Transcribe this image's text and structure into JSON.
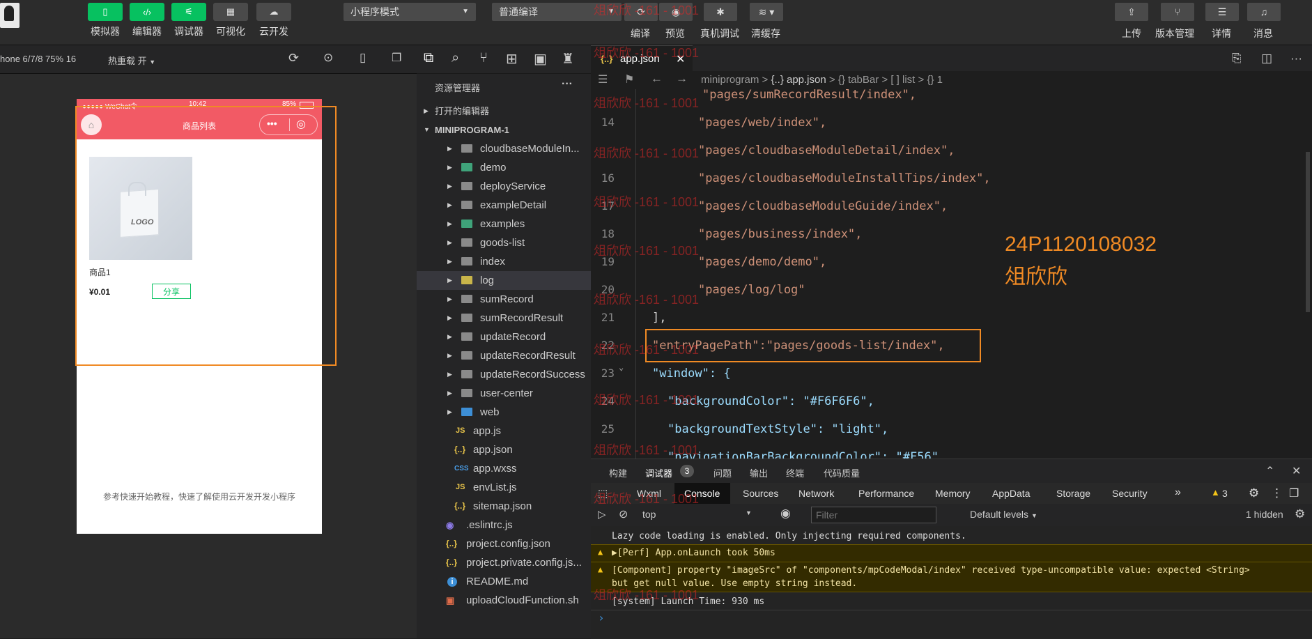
{
  "toolbar": {
    "buttons": [
      {
        "label": "模拟器",
        "icon": "phone-icon"
      },
      {
        "label": "编辑器",
        "icon": "code-icon"
      },
      {
        "label": "调试器",
        "icon": "debug-icon"
      },
      {
        "label": "可视化",
        "icon": "layout-icon"
      },
      {
        "label": "云开发",
        "icon": "cloud-icon"
      }
    ],
    "mode_select": "小程序模式",
    "compile_select": "普通编译",
    "actions": [
      {
        "label": "编译",
        "icon": "refresh-icon"
      },
      {
        "label": "预览",
        "icon": "eye-icon"
      },
      {
        "label": "真机调试",
        "icon": "bug-icon"
      },
      {
        "label": "清缓存",
        "icon": "layers-icon"
      }
    ],
    "right_actions": [
      {
        "label": "上传",
        "icon": "upload-icon"
      },
      {
        "label": "版本管理",
        "icon": "branch-icon"
      },
      {
        "label": "详情",
        "icon": "menu-icon"
      },
      {
        "label": "消息",
        "icon": "bell-icon"
      }
    ]
  },
  "simulator": {
    "device": "hone 6/7/8 75% 16",
    "hotreload": "热重载 开",
    "status_left": "●●●●● WeChat令",
    "status_time": "10:42",
    "status_battery": "85%",
    "nav_title": "商品列表",
    "product_name": "商品1",
    "product_price": "¥0.01",
    "share_label": "分享",
    "logo_text": "LOGO",
    "footer_text": "参考快速开始教程，快速了解使用云开发开发小程序"
  },
  "explorer": {
    "title": "资源管理器",
    "more": "···",
    "open_editors": "打开的编辑器",
    "project": "MINIPROGRAM-1",
    "folders": [
      "cloudbaseModuleIn...",
      "demo",
      "deployService",
      "exampleDetail",
      "examples",
      "goods-list",
      "index",
      "log",
      "sumRecord",
      "sumRecordResult",
      "updateRecord",
      "updateRecordResult",
      "updateRecordSuccess",
      "user-center",
      "web"
    ],
    "files": [
      {
        "name": "app.js",
        "icon": "JS"
      },
      {
        "name": "app.json",
        "icon": "{..}"
      },
      {
        "name": "app.wxss",
        "icon": "CSS"
      },
      {
        "name": "envList.js",
        "icon": "JS"
      },
      {
        "name": "sitemap.json",
        "icon": "{..}"
      }
    ],
    "root_files": [
      {
        "name": ".eslintrc.js",
        "icon": "◉"
      },
      {
        "name": "project.config.json",
        "icon": "{..}"
      },
      {
        "name": "project.private.config.js...",
        "icon": "{..}"
      },
      {
        "name": "README.md",
        "icon": "i"
      },
      {
        "name": "uploadCloudFunction.sh",
        "icon": "▣"
      }
    ]
  },
  "editor": {
    "tab": "app.json",
    "tab_icon": "{..}",
    "breadcrumb": [
      "miniprogram",
      ">",
      "{..} app.json",
      ">",
      "{} tabBar",
      ">",
      "[ ] list",
      ">",
      "{} 1"
    ],
    "lines": [
      {
        "n": "",
        "text": "\"pages/sumRecordResult/index\","
      },
      {
        "n": "14",
        "text": "\"pages/web/index\","
      },
      {
        "n": "",
        "text": "\"pages/cloudbaseModuleDetail/index\","
      },
      {
        "n": "16",
        "text": "\"pages/cloudbaseModuleInstallTips/index\","
      },
      {
        "n": "17",
        "text": "\"pages/cloudbaseModuleGuide/index\","
      },
      {
        "n": "18",
        "text": "\"pages/business/index\","
      },
      {
        "n": "19",
        "text": "\"pages/demo/demo\","
      },
      {
        "n": "20",
        "text": "\"pages/log/log\""
      },
      {
        "n": "21",
        "text": "],"
      },
      {
        "n": "22",
        "text": "\"entryPagePath\":\"pages/goods-list/index\","
      },
      {
        "n": "23",
        "text": "\"window\": {"
      },
      {
        "n": "24",
        "text": "\"backgroundColor\": \"#F6F6F6\","
      },
      {
        "n": "25",
        "text": "\"backgroundTextStyle\": \"light\","
      },
      {
        "n": "",
        "text": "\"navigationBarBackgroundColor\": \"#F56\""
      }
    ],
    "annotation_id": "24P1120108032",
    "annotation_name": "俎欣欣"
  },
  "panel": {
    "tabs": [
      "构建",
      "调试器",
      "问题",
      "输出",
      "终端",
      "代码质量"
    ],
    "debug_count": "3",
    "devtools_tabs": [
      "Wxml",
      "Console",
      "Sources",
      "Network",
      "Performance",
      "Memory",
      "AppData",
      "Storage",
      "Security"
    ],
    "more_tabs": "»",
    "warn_count": "3",
    "context": "top",
    "filter_placeholder": "Filter",
    "levels": "Default levels",
    "hidden": "1 hidden",
    "logs": [
      {
        "type": "info",
        "text": "Lazy code loading is enabled. Only injecting required components."
      },
      {
        "type": "warn",
        "text": "▶[Perf] App.onLaunch took 50ms"
      },
      {
        "type": "warn",
        "text": "[Component] property \"imageSrc\" of \"components/mpCodeModal/index\" received type-uncompatible value: expected <String>"
      },
      {
        "type": "warn2",
        "text": "but get null value. Use empty string instead."
      },
      {
        "type": "info",
        "text": "[system] Launch Time: 930 ms"
      }
    ],
    "prompt": "›"
  },
  "watermark": "俎欣欣 -161 - 1001",
  "colors": {
    "accent": "#07c160",
    "nav": "#f25a65",
    "highlight": "#f08a24",
    "annotation": "#f08a24"
  }
}
